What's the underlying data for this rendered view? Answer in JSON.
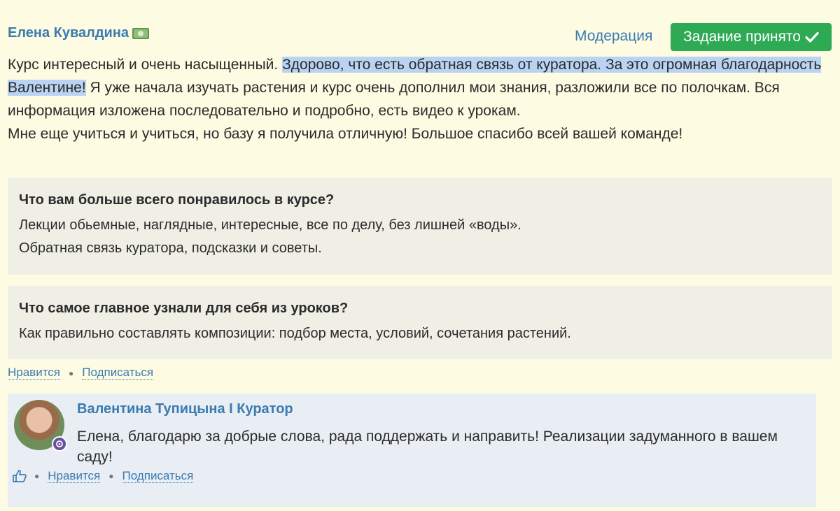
{
  "review": {
    "author": "Елена Кувалдина",
    "author_badge_icon": "money-icon",
    "moderation_label": "Модерация",
    "status_button_label": "Задание принято",
    "status_button_color": "#2eaa55",
    "text_part1": "Курс интересный и очень насыщенный. ",
    "text_highlight": "Здорово, что есть обратная связь от куратора. За это огромная благодарность Валентине!",
    "text_part2": " Я уже начала изучать растения и курс очень дополнил мои знания, разложили все по полочкам. Вся информация изложена последовательно и подробно, есть видео к урокам.",
    "text_line2": "Мне еще учиться и учиться, но базу я получила отличную! Большое спасибо всей вашей команде!",
    "questions": [
      {
        "question": "Что вам больше всего понравилось в курсе?",
        "answer_lines": [
          "Лекции обьемные, наглядные, интересные, все по делу, без лишней «воды».",
          "Обратная связь куратора, подсказки и советы."
        ]
      },
      {
        "question": "Что самое главное узнали для себя из уроков?",
        "answer_lines": [
          "Как правильно составлять композиции: подбор места, условий, сочетания растений."
        ]
      }
    ],
    "actions": {
      "like": "Нравится",
      "subscribe": "Подписаться"
    }
  },
  "reply": {
    "author": "Валентина Тупицына I Куратор",
    "text": "Елена, благодарю за добрые слова, рада поддержать и направить! Реализации задуманного в вашем саду!",
    "actions": {
      "like": "Нравится",
      "subscribe": "Подписаться"
    }
  },
  "colors": {
    "page_background": "#fefbe3",
    "link": "#3a7bb0",
    "highlight": "#b9d3f2",
    "card_background": "#efefe6",
    "reply_background": "#e9edf4"
  }
}
